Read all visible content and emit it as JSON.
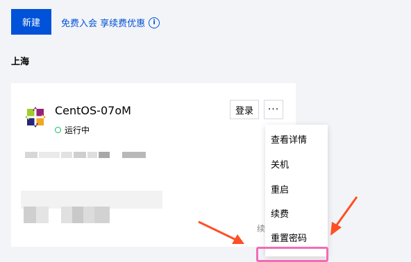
{
  "toolbar": {
    "new_label": "新建",
    "promo_label": "免费入会 享续费优惠",
    "info_glyph": "i"
  },
  "region": "上海",
  "instance": {
    "name": "CentOS-07oM",
    "status": "运行中",
    "login_label": "登录",
    "more_label": "···",
    "renew_partial": "续"
  },
  "menu": {
    "items": [
      "查看详情",
      "关机",
      "重启",
      "续费",
      "重置密码"
    ]
  },
  "colors": {
    "primary": "#0052d9",
    "running": "#0abf5b",
    "arrow": "#ff4f24",
    "highlight": "#f36bb5"
  }
}
